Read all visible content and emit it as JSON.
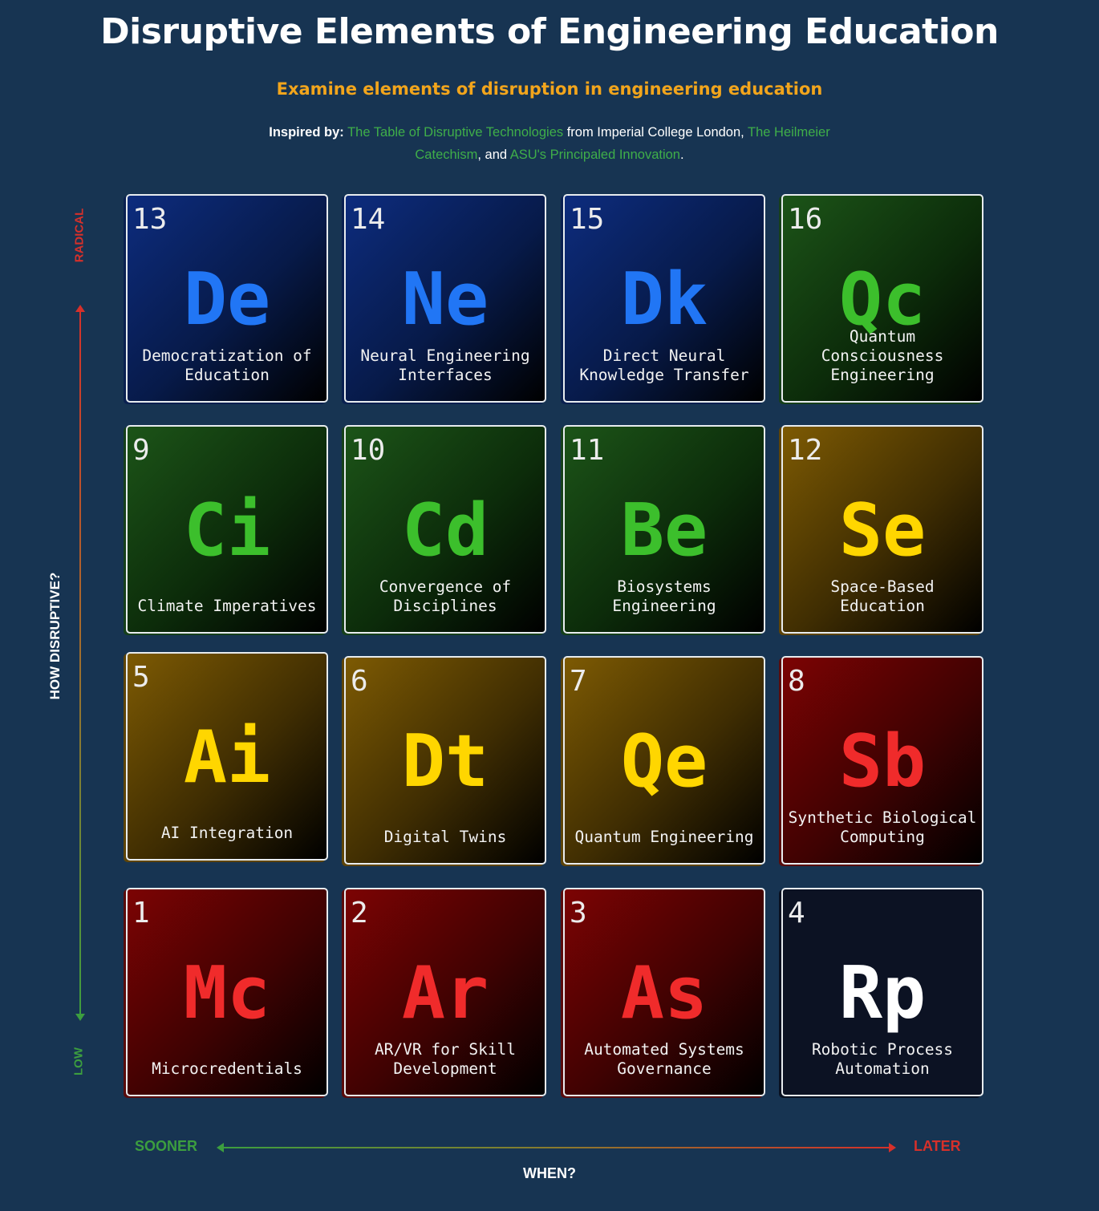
{
  "header": {
    "title": "Disruptive Elements of Engineering Education",
    "subtitle": "Examine elements of disruption in engineering education",
    "inspired_label": "Inspired by:",
    "link1": "The Table of Disruptive Technologies",
    "text1": " from Imperial College London, ",
    "link2": "The Heilmeier Catechism",
    "text2": ", and ",
    "link3": "ASU's Principaled Innovation",
    "text3": "."
  },
  "axes": {
    "y_top": "RADICAL",
    "y_bottom": "LOW",
    "y_title": "HOW DISRUPTIVE?",
    "x_left": "SOONER",
    "x_right": "LATER",
    "x_title": "WHEN?"
  },
  "colors": {
    "background": "#173452",
    "subtitle": "#f2a51c",
    "link": "#3fae49",
    "blue": "#2176f5",
    "green": "#3cbf2c",
    "yellow": "#ffd600",
    "red": "#f02b2b",
    "white": "#ffffff"
  },
  "elements": [
    {
      "number": "13",
      "symbol": "De",
      "name": "Democratization of\nEducation",
      "color": "blue"
    },
    {
      "number": "14",
      "symbol": "Ne",
      "name": "Neural Engineering\nInterfaces",
      "color": "blue"
    },
    {
      "number": "15",
      "symbol": "Dk",
      "name": "Direct Neural\nKnowledge Transfer",
      "color": "blue"
    },
    {
      "number": "16",
      "symbol": "Qc",
      "name": "Quantum\nConsciousness\nEngineering",
      "color": "green"
    },
    {
      "number": "9",
      "symbol": "Ci",
      "name": "Climate Imperatives",
      "color": "green"
    },
    {
      "number": "10",
      "symbol": "Cd",
      "name": "Convergence of\nDisciplines",
      "color": "green"
    },
    {
      "number": "11",
      "symbol": "Be",
      "name": "Biosystems\nEngineering",
      "color": "green"
    },
    {
      "number": "12",
      "symbol": "Se",
      "name": "Space-Based\nEducation",
      "color": "yellow"
    },
    {
      "number": "5",
      "symbol": "Ai",
      "name": "AI Integration",
      "color": "yellow"
    },
    {
      "number": "6",
      "symbol": "Dt",
      "name": "Digital Twins",
      "color": "yellow"
    },
    {
      "number": "7",
      "symbol": "Qe",
      "name": "Quantum Engineering",
      "color": "yellow"
    },
    {
      "number": "8",
      "symbol": "Sb",
      "name": "Synthetic Biological\nComputing",
      "color": "red"
    },
    {
      "number": "1",
      "symbol": "Mc",
      "name": "Microcredentials",
      "color": "red"
    },
    {
      "number": "2",
      "symbol": "Ar",
      "name": "AR/VR for Skill\nDevelopment",
      "color": "red"
    },
    {
      "number": "3",
      "symbol": "As",
      "name": "Automated Systems\nGovernance",
      "color": "red"
    },
    {
      "number": "4",
      "symbol": "Rp",
      "name": "Robotic Process\nAutomation",
      "color": "dark"
    }
  ]
}
